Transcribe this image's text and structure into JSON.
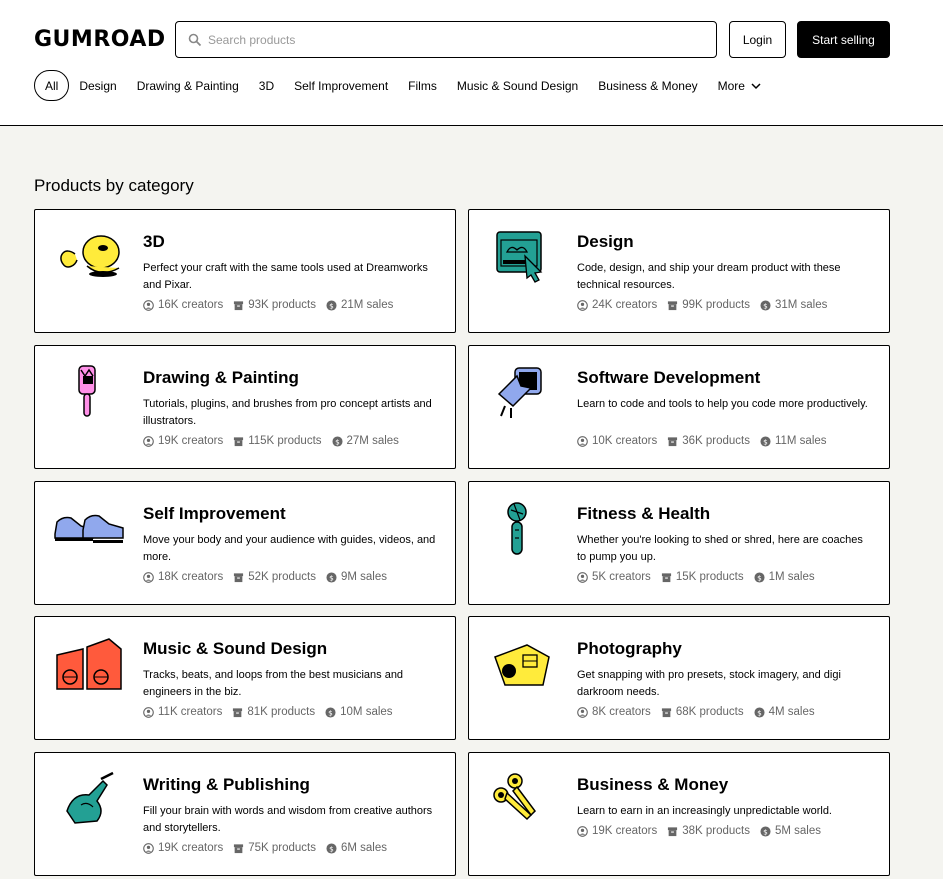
{
  "header": {
    "logo": "GUMROAD",
    "search_placeholder": "Search products",
    "login_label": "Login",
    "start_selling_label": "Start selling"
  },
  "nav": {
    "items": [
      "All",
      "Design",
      "Drawing & Painting",
      "3D",
      "Self Improvement",
      "Films",
      "Music & Sound Design",
      "Business & Money",
      "More"
    ]
  },
  "section_title": "Products by category",
  "colors": {
    "accent_pink": "#ff90e8",
    "yellow": "#ffeb3b",
    "teal": "#23a094",
    "blue": "#90a8ed",
    "red": "#ff5a3c"
  },
  "categories": [
    {
      "title": "3D",
      "description": "Perfect your craft with the same tools used at Dreamworks and Pixar.",
      "creators": "16K creators",
      "products": "93K products",
      "sales": "21M sales",
      "icon": "3d-blob-icon"
    },
    {
      "title": "Design",
      "description": "Code, design, and ship your dream product with these technical resources.",
      "creators": "24K creators",
      "products": "99K products",
      "sales": "31M sales",
      "icon": "design-window-icon"
    },
    {
      "title": "Drawing & Painting",
      "description": "Tutorials, plugins, and brushes from pro concept artists and illustrators.",
      "creators": "19K creators",
      "products": "115K products",
      "sales": "27M sales",
      "icon": "paintbrush-icon"
    },
    {
      "title": "Software Development",
      "description": "Learn to code and tools to help you code more productively.",
      "creators": "10K creators",
      "products": "36K products",
      "sales": "11M sales",
      "icon": "cursor-click-icon"
    },
    {
      "title": "Self Improvement",
      "description": "Move your body and your audience with guides, videos, and more.",
      "creators": "18K creators",
      "products": "52K products",
      "sales": "9M sales",
      "icon": "sneakers-icon"
    },
    {
      "title": "Fitness & Health",
      "description": "Whether you're looking to shed or shred, here are coaches to pump you up.",
      "creators": "5K creators",
      "products": "15K products",
      "sales": "1M sales",
      "icon": "fitness-icon"
    },
    {
      "title": "Music & Sound Design",
      "description": "Tracks, beats, and loops from the best musicians and engineers in the biz.",
      "creators": "11K creators",
      "products": "81K products",
      "sales": "10M sales",
      "icon": "speakers-icon"
    },
    {
      "title": "Photography",
      "description": "Get snapping with pro presets, stock imagery, and digi darkroom needs.",
      "creators": "8K creators",
      "products": "68K products",
      "sales": "4M sales",
      "icon": "camera-icon"
    },
    {
      "title": "Writing & Publishing",
      "description": "Fill your brain with words and wisdom from creative authors and storytellers.",
      "creators": "19K creators",
      "products": "75K products",
      "sales": "6M sales",
      "icon": "writing-hand-icon"
    },
    {
      "title": "Business & Money",
      "description": "Learn to earn in an increasingly unpredictable world.",
      "creators": "19K creators",
      "products": "38K products",
      "sales": "5M sales",
      "icon": "scissors-icon"
    }
  ]
}
